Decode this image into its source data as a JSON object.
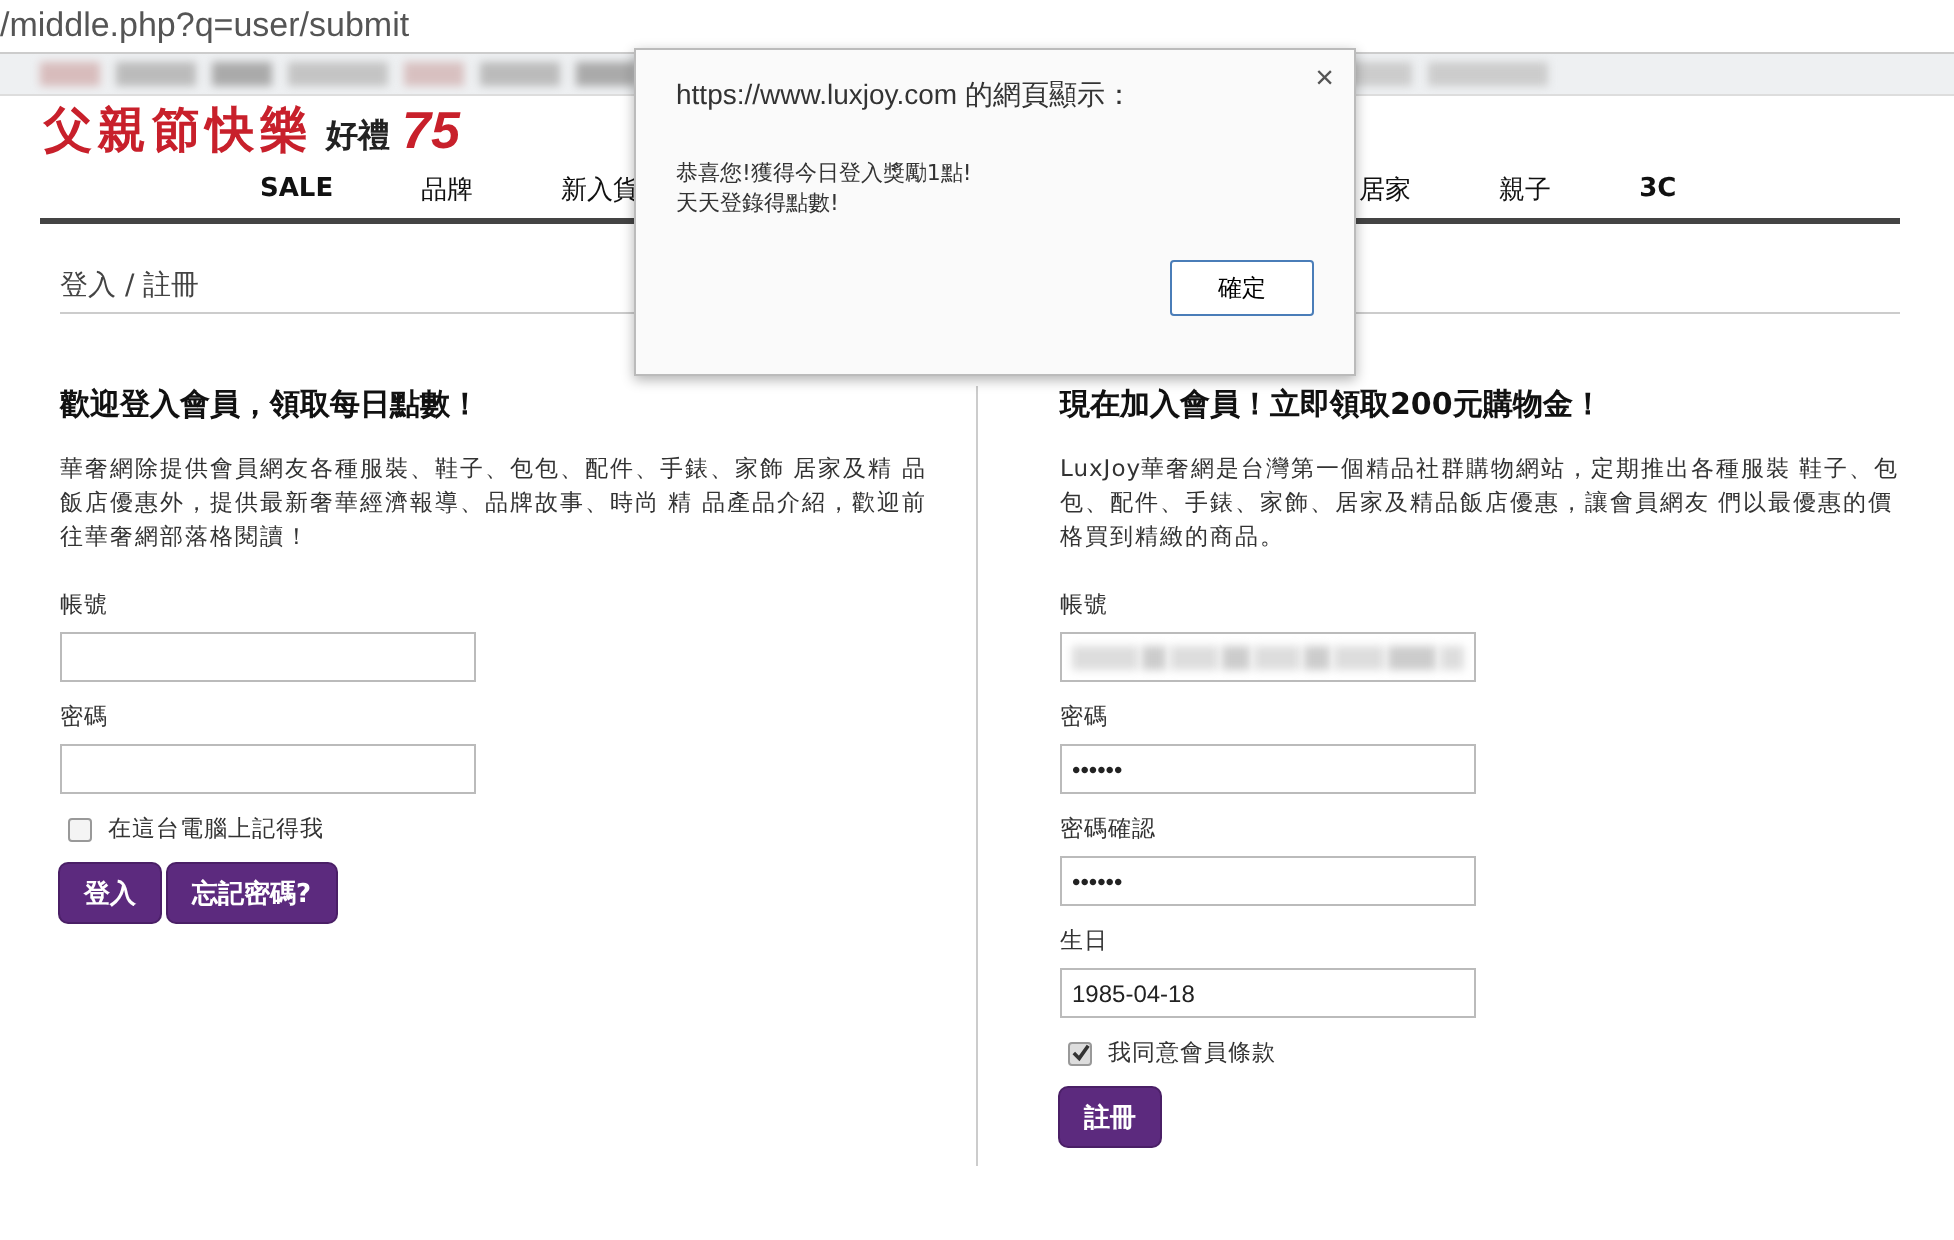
{
  "address_bar": {
    "url": "/middle.php?q=user/submit"
  },
  "banner": {
    "headline": "父親節快樂",
    "gift": "好禮",
    "discount": "75"
  },
  "nav": {
    "items": [
      {
        "label": "SALE",
        "bold": true
      },
      {
        "label": "品牌",
        "bold": false
      },
      {
        "label": "新入貨",
        "bold": false
      },
      {
        "label": "居家",
        "bold": false
      },
      {
        "label": "親子",
        "bold": false
      },
      {
        "label": "3C",
        "bold": true
      }
    ]
  },
  "breadcrumb": "登入 / 註冊",
  "login": {
    "title": "歡迎登入會員，領取每日點數！",
    "intro": "華奢網除提供會員網友各種服裝、鞋子、包包、配件、手錶、家飾 居家及精 品飯店優惠外，提供最新奢華經濟報導、品牌故事、時尚 精 品產品介紹，歡迎前往華奢網部落格閱讀！",
    "fields": [
      {
        "label": "帳號"
      },
      {
        "label": "密碼"
      }
    ],
    "remember": {
      "label": "在這台電腦上記得我",
      "checked": false
    },
    "buttons": [
      "登入",
      "忘記密碼?"
    ]
  },
  "register": {
    "title": "現在加入會員！立即領取200元購物金！",
    "intro": "LuxJoy華奢網是台灣第一個精品社群購物網站，定期推出各種服裝 鞋子、包包、配件、手錶、家飾、居家及精品飯店優惠，讓會員網友 們以最優惠的價格買到精緻的商品。",
    "fields": [
      {
        "label": "帳號",
        "blurred": true
      },
      {
        "label": "密碼",
        "value": "••••••"
      },
      {
        "label": "密碼確認",
        "value": "••••••"
      },
      {
        "label": "生日",
        "value": "1985-04-18"
      }
    ],
    "agree": {
      "label": "我同意會員條款",
      "checked": true
    },
    "button": "註冊"
  },
  "dialog": {
    "title": "https://www.luxjoy.com 的網頁顯示：",
    "close": "×",
    "lines": [
      "恭喜您!獲得今日登入獎勵1點!",
      "天天登錄得點數!"
    ],
    "button": "確定"
  }
}
